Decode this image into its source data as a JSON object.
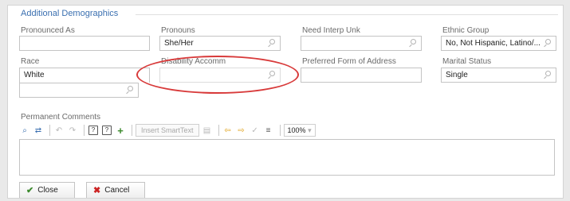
{
  "section": {
    "title": "Additional Demographics"
  },
  "fields": {
    "pronounced_as": {
      "label": "Pronounced As",
      "value": ""
    },
    "pronouns": {
      "label": "Pronouns",
      "value": "She/Her"
    },
    "need_interp": {
      "label": "Need Interp Unk",
      "value": ""
    },
    "ethnic_group": {
      "label": "Ethnic Group",
      "value": "No, Not Hispanic, Latino/..."
    },
    "race": {
      "label": "Race",
      "value": "White",
      "extra_value": ""
    },
    "disability": {
      "label": "Disability Accomm",
      "value": ""
    },
    "preferred_address": {
      "label": "Preferred Form of Address",
      "value": ""
    },
    "marital_status": {
      "label": "Marital Status",
      "value": "Single"
    }
  },
  "comments": {
    "label": "Permanent Comments",
    "toolbar": {
      "smarttext_label": "Insert SmartText",
      "zoom_value": "100%",
      "icons": [
        "spell-check-icon",
        "spell-settings-icon",
        "undo-icon",
        "redo-icon",
        "smartphrase-icon",
        "smartphrase-manager-icon",
        "add-icon",
        "insert-smarttext-icon",
        "prev-field-icon",
        "next-field-icon",
        "accept-icon",
        "format-icon",
        "zoom-dropdown-icon"
      ]
    },
    "value": ""
  },
  "buttons": {
    "close_label": "Close",
    "cancel_label": "Cancel"
  },
  "colors": {
    "title": "#3a6fb0",
    "highlight_ellipse": "#d83a3a",
    "check": "#3c8a2e",
    "cancel_x": "#cc2222",
    "arrows": "#e0a21a"
  }
}
